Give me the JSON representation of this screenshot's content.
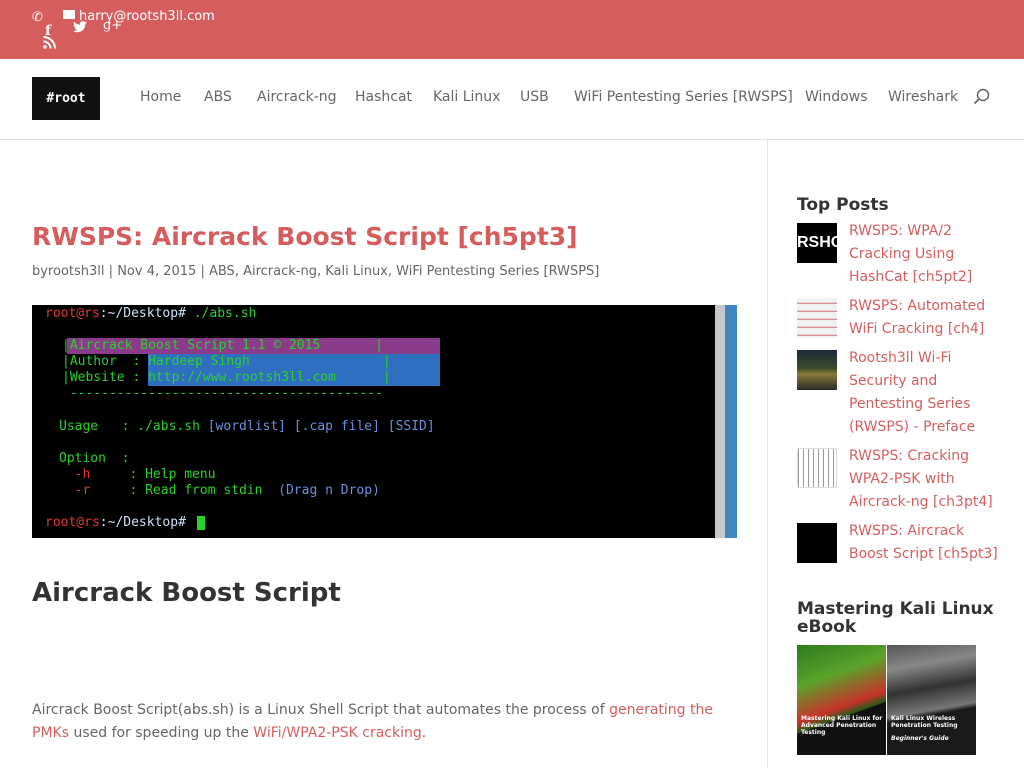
{
  "topbar": {
    "email": "harry@rootsh3ll.com",
    "icons": [
      "phone-icon",
      "mail-icon",
      "facebook-icon",
      "twitter-icon",
      "google-plus-icon",
      "rss-icon"
    ]
  },
  "header": {
    "logo": "#root",
    "nav": [
      "Home",
      "ABS",
      "Aircrack-ng",
      "Hashcat",
      "Kali Linux",
      "USB",
      "WiFi Pentesting Series [RWSPS]",
      "Windows",
      "Wireshark"
    ]
  },
  "post": {
    "title": "RWSPS: Aircrack Boost Script [ch5pt3]",
    "meta": {
      "by": "by",
      "author": "rootsh3ll",
      "sep1": " | ",
      "date": "Nov 4, 2015",
      "sep2": " | ",
      "cat1": "ABS",
      "comma1": ", ",
      "cat2": "Aircrack-ng",
      "comma2": ", ",
      "cat3": "Kali Linux",
      "comma3": ", ",
      "cat4": "WiFi Pentesting Series [RWSPS]"
    },
    "terminal": {
      "prompt_user": "root@rs",
      "prompt_path": ":~/Desktop#",
      "cmd": " ./abs.sh",
      "l1": "|Aircrack Boost Script 1.1 © 2015       |",
      "l2": "|Author  : Hardeep Singh                 |",
      "l3": "|Website : http://www.rootsh3ll.com      |",
      "l4": " ---------------------------------------- ",
      "usage_label": "Usage   :",
      "usage_cmd": " ./abs.sh",
      "usage_args": " [wordlist] [.cap file] [SSID]",
      "option_label": "Option  :",
      "opt_h": "  -h",
      "opt_h_desc": "     : Help menu",
      "opt_r": "  -r",
      "opt_r_desc": "     : Read from stdin",
      "opt_r_extra": "  (Drag n Drop)"
    },
    "heading": "Aircrack Boost Script",
    "para_before": "Aircrack Boost Script(abs.sh) is a Linux Shell Script that automates the process of ",
    "para_link1": "generating the PMKs",
    "para_mid": " used for speeding up the ",
    "para_link2": "WiFi/WPA2-PSK cracking",
    "para_after": "."
  },
  "sidebar": {
    "top_posts_title": "Top Posts",
    "top_posts": [
      "RWSPS: WPA/2 Cracking Using HashCat [ch5pt2]",
      "RWSPS: Automated WiFi Cracking [ch4]",
      "Rootsh3ll Wi-Fi Security and Pentesting Series (RWSPS) - Preface",
      "RWSPS: Cracking WPA2-PSK with Aircrack-ng [ch3pt4]",
      "RWSPS: Aircrack Boost Script [ch5pt3]"
    ],
    "thumb1_text": "RSHC",
    "ebook_title": "Mastering Kali Linux eBook",
    "book1_caption": "Mastering Kali Linux for Advanced Penetration Testing",
    "book2_caption": "Kali Linux Wireless Penetration Testing",
    "book2_sub": "Beginner's Guide"
  },
  "colors": {
    "accent": "#d55d5e",
    "text": "#666666",
    "heading": "#333333"
  }
}
